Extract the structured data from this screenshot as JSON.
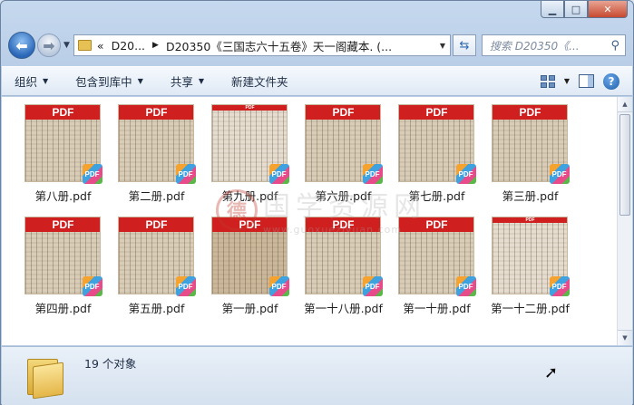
{
  "window": {
    "caption": {
      "minimize": "▁",
      "maximize": "□",
      "close": "✕"
    }
  },
  "nav": {
    "history_dropdown": "▼",
    "breadcrumb": [
      "«",
      "D20...",
      "D20350《三国志六十五卷》天一阁藏本. (..."
    ],
    "search_placeholder": "搜索 D20350《..."
  },
  "toolbar": {
    "items": [
      {
        "label": "组织",
        "dropdown": true
      },
      {
        "label": "包含到库中",
        "dropdown": true
      },
      {
        "label": "共享",
        "dropdown": true
      },
      {
        "label": "新建文件夹",
        "dropdown": false
      }
    ]
  },
  "files": [
    {
      "name": "第八册.pdf",
      "style": "normal"
    },
    {
      "name": "第二册.pdf",
      "style": "normal"
    },
    {
      "name": "第九册.pdf",
      "style": "thin"
    },
    {
      "name": "第六册.pdf",
      "style": "normal"
    },
    {
      "name": "第七册.pdf",
      "style": "normal"
    },
    {
      "name": "第三册.pdf",
      "style": "normal"
    },
    {
      "name": "第四册.pdf",
      "style": "normal"
    },
    {
      "name": "第五册.pdf",
      "style": "normal"
    },
    {
      "name": "第一册.pdf",
      "style": "dark"
    },
    {
      "name": "第一十八册.pdf",
      "style": "normal"
    },
    {
      "name": "第一十册.pdf",
      "style": "normal"
    },
    {
      "name": "第一十二册.pdf",
      "style": "thin"
    }
  ],
  "pdf_banner": "PDF",
  "pdf_badge": "PDF",
  "watermark": {
    "seal": "德",
    "text": "国学资源网",
    "url": "www.guoxueziyuan.com"
  },
  "status": {
    "count_text": "19 个对象"
  },
  "colors": {
    "pdf_red": "#d01f1f",
    "toolbar_bg": "#dfe9f5",
    "folder": "#e4b649"
  }
}
